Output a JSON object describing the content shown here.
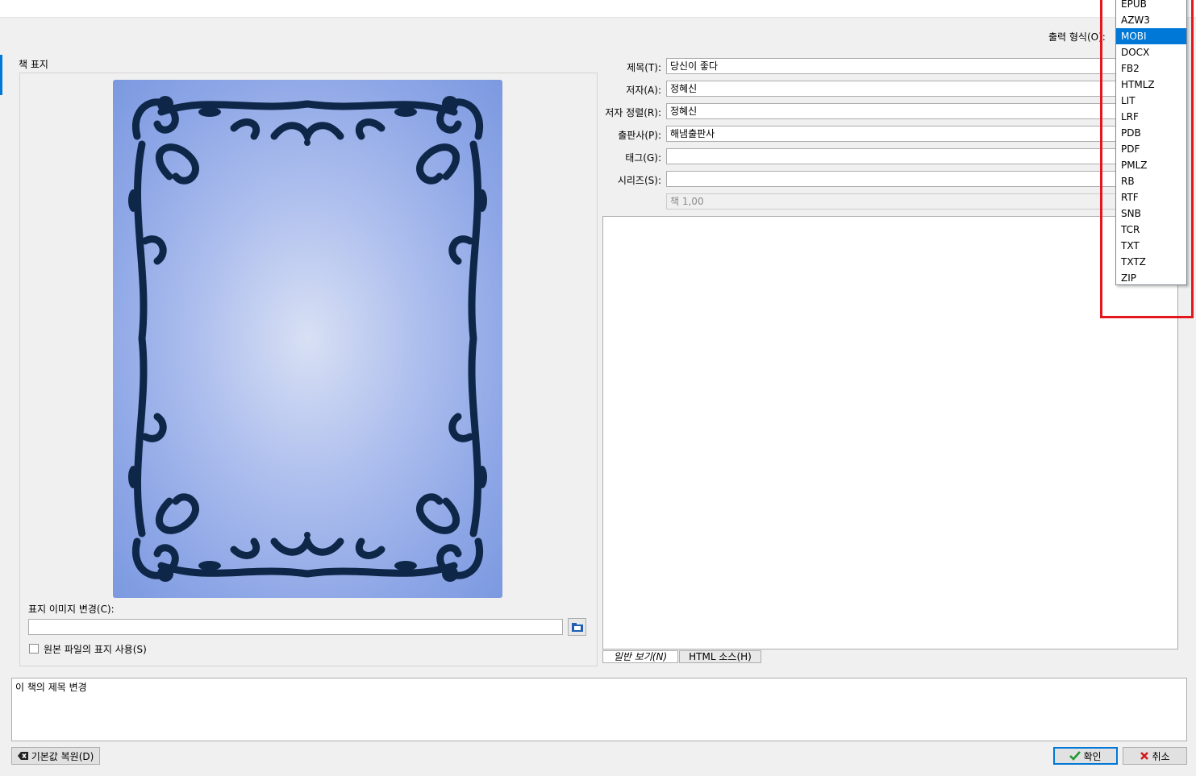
{
  "output_format": {
    "label": "출력 형식(O):"
  },
  "cover_section": {
    "title": "책 표지",
    "change_label": "표지 이미지 변경(C):",
    "path_value": "",
    "use_source_cover_label": "원본 파일의 표지 사용(S)"
  },
  "metadata": {
    "title_label": "제목(T):",
    "title_value": "당신이 좋다",
    "author_label": "저자(A):",
    "author_value": "정혜신",
    "author_sort_label": "저자 정렬(R):",
    "author_sort_value": "정혜신",
    "publisher_label": "출판사(P):",
    "publisher_value": "해냄출판사",
    "tags_label": "태그(G):",
    "tags_value": "",
    "series_label": "시리즈(S):",
    "series_value": "",
    "series_index_value": "책 1,00"
  },
  "comment_tabs": {
    "normal": "일반 보기(N)",
    "html": "HTML 소스(H)"
  },
  "message_box": {
    "text": "이 책의 제목 변경"
  },
  "buttons": {
    "restore_defaults": "기본값 복원(D)",
    "ok": "확인",
    "cancel": "취소"
  },
  "dropdown": {
    "items": [
      "EPUB",
      "AZW3",
      "MOBI",
      "DOCX",
      "FB2",
      "HTMLZ",
      "LIT",
      "LRF",
      "PDB",
      "PDF",
      "PMLZ",
      "RB",
      "RTF",
      "SNB",
      "TCR",
      "TXT",
      "TXTZ",
      "ZIP"
    ],
    "selected": "MOBI"
  },
  "colors": {
    "highlight": "#0078d7",
    "annotation": "#e2181e",
    "ornament": "#0e2748"
  }
}
